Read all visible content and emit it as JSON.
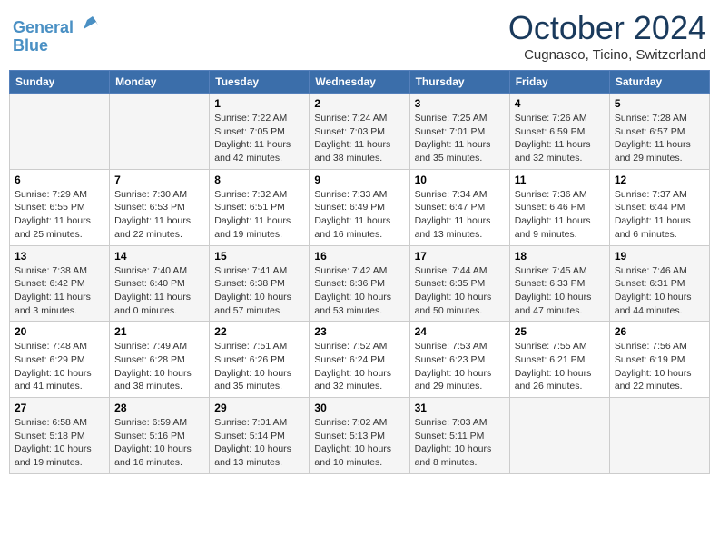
{
  "header": {
    "logo_line1": "General",
    "logo_line2": "Blue",
    "month": "October 2024",
    "location": "Cugnasco, Ticino, Switzerland"
  },
  "weekdays": [
    "Sunday",
    "Monday",
    "Tuesday",
    "Wednesday",
    "Thursday",
    "Friday",
    "Saturday"
  ],
  "weeks": [
    [
      {
        "day": "",
        "info": ""
      },
      {
        "day": "",
        "info": ""
      },
      {
        "day": "1",
        "info": "Sunrise: 7:22 AM\nSunset: 7:05 PM\nDaylight: 11 hours and 42 minutes."
      },
      {
        "day": "2",
        "info": "Sunrise: 7:24 AM\nSunset: 7:03 PM\nDaylight: 11 hours and 38 minutes."
      },
      {
        "day": "3",
        "info": "Sunrise: 7:25 AM\nSunset: 7:01 PM\nDaylight: 11 hours and 35 minutes."
      },
      {
        "day": "4",
        "info": "Sunrise: 7:26 AM\nSunset: 6:59 PM\nDaylight: 11 hours and 32 minutes."
      },
      {
        "day": "5",
        "info": "Sunrise: 7:28 AM\nSunset: 6:57 PM\nDaylight: 11 hours and 29 minutes."
      }
    ],
    [
      {
        "day": "6",
        "info": "Sunrise: 7:29 AM\nSunset: 6:55 PM\nDaylight: 11 hours and 25 minutes."
      },
      {
        "day": "7",
        "info": "Sunrise: 7:30 AM\nSunset: 6:53 PM\nDaylight: 11 hours and 22 minutes."
      },
      {
        "day": "8",
        "info": "Sunrise: 7:32 AM\nSunset: 6:51 PM\nDaylight: 11 hours and 19 minutes."
      },
      {
        "day": "9",
        "info": "Sunrise: 7:33 AM\nSunset: 6:49 PM\nDaylight: 11 hours and 16 minutes."
      },
      {
        "day": "10",
        "info": "Sunrise: 7:34 AM\nSunset: 6:47 PM\nDaylight: 11 hours and 13 minutes."
      },
      {
        "day": "11",
        "info": "Sunrise: 7:36 AM\nSunset: 6:46 PM\nDaylight: 11 hours and 9 minutes."
      },
      {
        "day": "12",
        "info": "Sunrise: 7:37 AM\nSunset: 6:44 PM\nDaylight: 11 hours and 6 minutes."
      }
    ],
    [
      {
        "day": "13",
        "info": "Sunrise: 7:38 AM\nSunset: 6:42 PM\nDaylight: 11 hours and 3 minutes."
      },
      {
        "day": "14",
        "info": "Sunrise: 7:40 AM\nSunset: 6:40 PM\nDaylight: 11 hours and 0 minutes."
      },
      {
        "day": "15",
        "info": "Sunrise: 7:41 AM\nSunset: 6:38 PM\nDaylight: 10 hours and 57 minutes."
      },
      {
        "day": "16",
        "info": "Sunrise: 7:42 AM\nSunset: 6:36 PM\nDaylight: 10 hours and 53 minutes."
      },
      {
        "day": "17",
        "info": "Sunrise: 7:44 AM\nSunset: 6:35 PM\nDaylight: 10 hours and 50 minutes."
      },
      {
        "day": "18",
        "info": "Sunrise: 7:45 AM\nSunset: 6:33 PM\nDaylight: 10 hours and 47 minutes."
      },
      {
        "day": "19",
        "info": "Sunrise: 7:46 AM\nSunset: 6:31 PM\nDaylight: 10 hours and 44 minutes."
      }
    ],
    [
      {
        "day": "20",
        "info": "Sunrise: 7:48 AM\nSunset: 6:29 PM\nDaylight: 10 hours and 41 minutes."
      },
      {
        "day": "21",
        "info": "Sunrise: 7:49 AM\nSunset: 6:28 PM\nDaylight: 10 hours and 38 minutes."
      },
      {
        "day": "22",
        "info": "Sunrise: 7:51 AM\nSunset: 6:26 PM\nDaylight: 10 hours and 35 minutes."
      },
      {
        "day": "23",
        "info": "Sunrise: 7:52 AM\nSunset: 6:24 PM\nDaylight: 10 hours and 32 minutes."
      },
      {
        "day": "24",
        "info": "Sunrise: 7:53 AM\nSunset: 6:23 PM\nDaylight: 10 hours and 29 minutes."
      },
      {
        "day": "25",
        "info": "Sunrise: 7:55 AM\nSunset: 6:21 PM\nDaylight: 10 hours and 26 minutes."
      },
      {
        "day": "26",
        "info": "Sunrise: 7:56 AM\nSunset: 6:19 PM\nDaylight: 10 hours and 22 minutes."
      }
    ],
    [
      {
        "day": "27",
        "info": "Sunrise: 6:58 AM\nSunset: 5:18 PM\nDaylight: 10 hours and 19 minutes."
      },
      {
        "day": "28",
        "info": "Sunrise: 6:59 AM\nSunset: 5:16 PM\nDaylight: 10 hours and 16 minutes."
      },
      {
        "day": "29",
        "info": "Sunrise: 7:01 AM\nSunset: 5:14 PM\nDaylight: 10 hours and 13 minutes."
      },
      {
        "day": "30",
        "info": "Sunrise: 7:02 AM\nSunset: 5:13 PM\nDaylight: 10 hours and 10 minutes."
      },
      {
        "day": "31",
        "info": "Sunrise: 7:03 AM\nSunset: 5:11 PM\nDaylight: 10 hours and 8 minutes."
      },
      {
        "day": "",
        "info": ""
      },
      {
        "day": "",
        "info": ""
      }
    ]
  ]
}
